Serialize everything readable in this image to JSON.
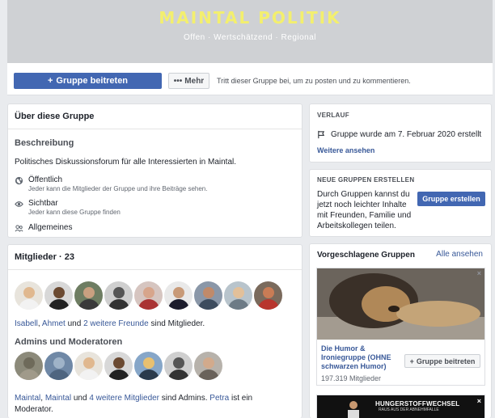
{
  "cover": {
    "title": "MAINTAL POLITIK",
    "subtitle": "Offen · Wertschätzend · Regional"
  },
  "actionbar": {
    "join_label": "Gruppe beitreten",
    "more_label": "Mehr",
    "hint": "Tritt dieser Gruppe bei, um zu posten und zu kommentieren."
  },
  "about": {
    "header": "Über diese Gruppe",
    "description_title": "Beschreibung",
    "description": "Politisches Diskussionsforum für alle Interessierten in Maintal.",
    "privacy": {
      "label": "Öffentlich",
      "sub": "Jeder kann die Mitglieder der Gruppe und ihre Beiträge sehen."
    },
    "visibility": {
      "label": "Sichtbar",
      "sub": "Jeder kann diese Gruppe finden"
    },
    "category": "Allgemeines"
  },
  "members": {
    "header": "Mitglieder · 23",
    "friends": {
      "name1": "Isabell",
      "sep": ", ",
      "name2": "Ahmet",
      "and": " und ",
      "others": "2 weitere Freunde",
      "tail": " sind Mitglieder."
    },
    "admins_title": "Admins und Moderatoren",
    "admins": {
      "n1": "Maintal",
      "sep": ", ",
      "n2": "Maintal",
      "and": " und ",
      "others": "4 weitere Mitglieder",
      "mid": " sind Admins. ",
      "n3": "Petra",
      "tail": " ist ein Moderator."
    }
  },
  "history": {
    "header": "VERLAUF",
    "entry": "Gruppe wurde am 7. Februar 2020 erstellt",
    "see_more": "Weitere ansehen"
  },
  "create": {
    "header": "NEUE GRUPPEN ERSTELLEN",
    "text": "Durch Gruppen kannst du jetzt noch leichter Inhalte mit Freunden, Familie und Arbeitskollegen teilen.",
    "button": "Gruppe erstellen"
  },
  "suggested": {
    "header": "Vorgeschlagene Gruppen",
    "see_all": "Alle ansehen",
    "group_name": "Die Humor & Ironiegruppe (OHNE schwarzen Humor)",
    "group_members": "197.319 Mitglieder",
    "join": "Gruppe beitreten",
    "next_banner": "HUNGERSTOFFWECHSEL",
    "next_banner_sub": "RAUS AUS DER ABNEHMFALLE"
  },
  "colors": {
    "accent": "#4267b2",
    "link": "#385898",
    "cover_title": "#f3ef6e"
  }
}
